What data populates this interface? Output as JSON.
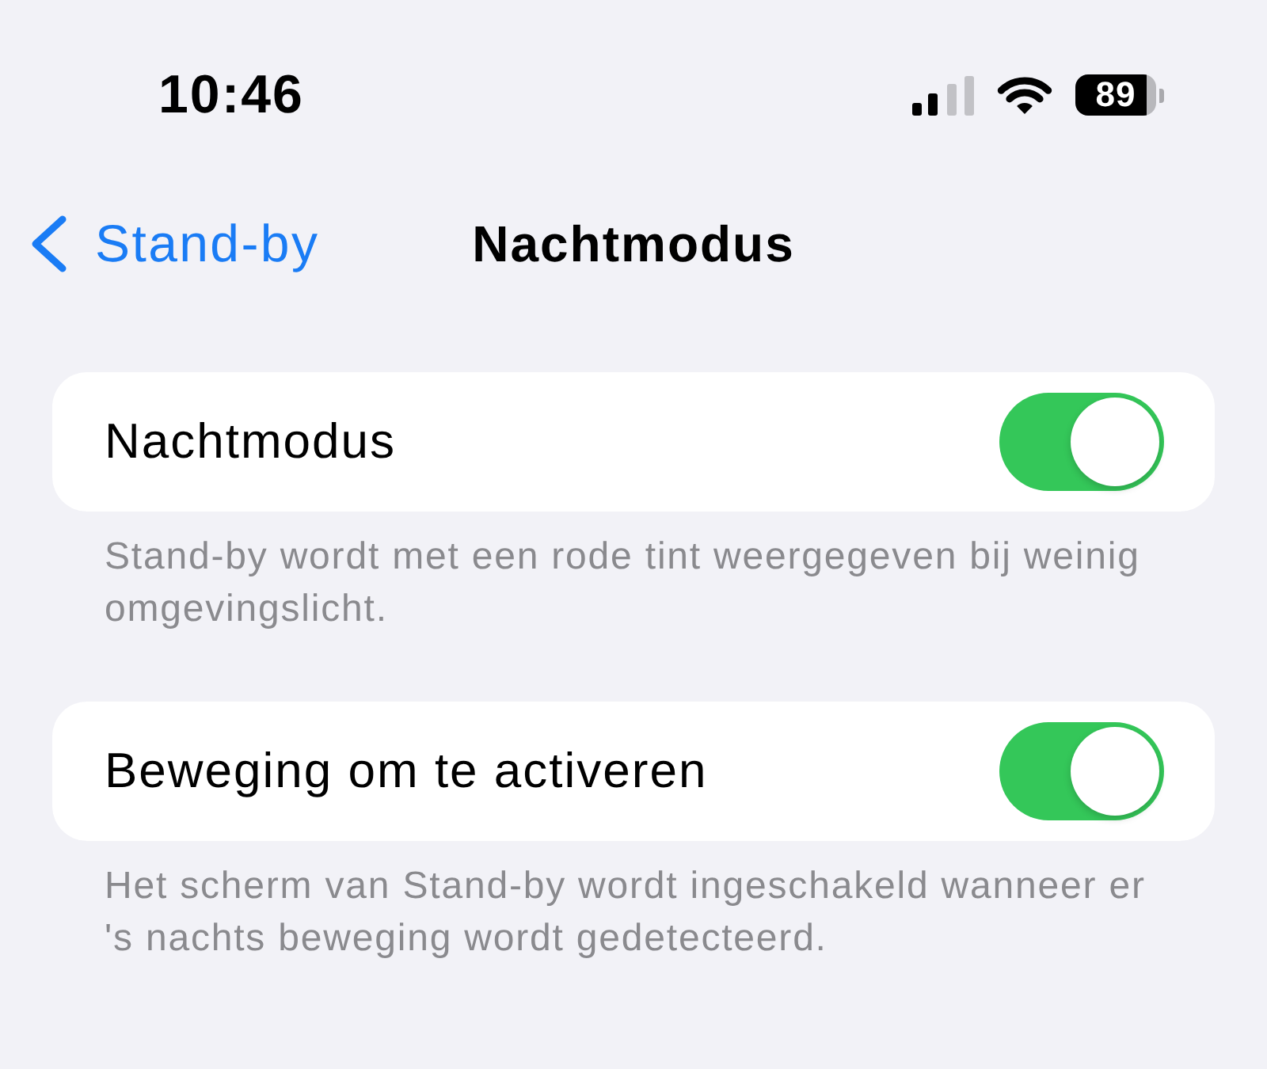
{
  "status_bar": {
    "time": "10:46",
    "battery": "89"
  },
  "nav": {
    "back": "Stand-by",
    "title": "Nachtmodus"
  },
  "sections": [
    {
      "label": "Nachtmodus",
      "on": true,
      "footer": "Stand-by wordt met een rode tint weergegeven bij weinig omgevingslicht."
    },
    {
      "label": "Beweging om te activeren",
      "on": true,
      "footer": "Het scherm van Stand-by wordt ingeschakeld wanneer er 's nachts beweging wordt gedetecteerd."
    }
  ]
}
